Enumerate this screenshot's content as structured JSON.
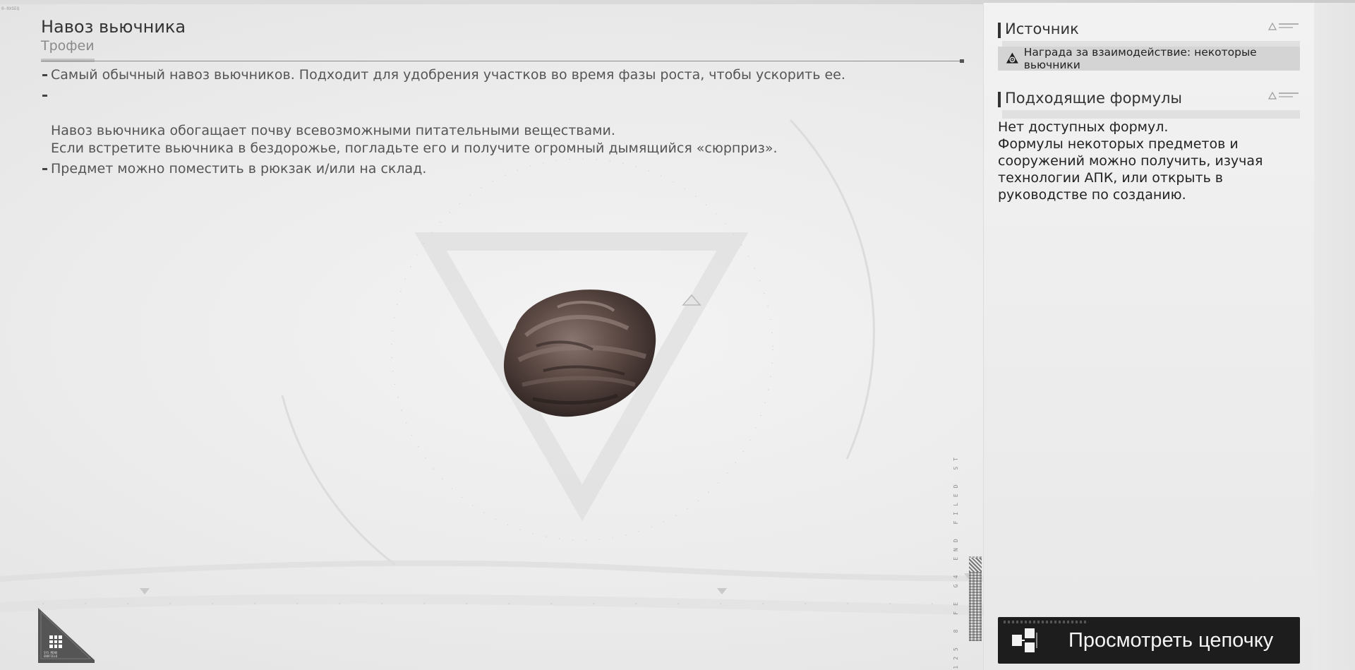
{
  "item": {
    "title": "Навоз вьючника",
    "category": "Трофеи",
    "description": [
      "Самый обычный навоз вьючников. Подходит для удобрения участков во время фазы роста, чтобы ускорить ее.",
      "Навоз вьючника обогащает почву всевозможными питательными веществами.\nЕсли встретите вьючника в бездорожье, погладьте его и получите огромный дымящийся «сюрприз».",
      "Предмет можно поместить в рюкзак и/или на склад."
    ],
    "model_icon": "dung-pile-icon"
  },
  "source": {
    "heading": "Источник",
    "entries": [
      {
        "icon": "interaction-reward-icon",
        "text": "Награда за взаимодействие: некоторые вьючники"
      }
    ]
  },
  "formulas": {
    "heading": "Подходящие формулы",
    "empty_text": "Нет доступных формул.\nФормулы некоторых предметов и сооружений можно получить, изучая технологии АПК, или открыть в руководстве по созданию."
  },
  "actions": {
    "view_chain_label": "Просмотреть цепочку",
    "view_chain_icon": "production-chain-icon",
    "menu_icon": "grid-menu-icon"
  },
  "colors": {
    "background": "#ebebeb",
    "panel": "#efefef",
    "button": "#1d1d1d",
    "text_dark": "#222222",
    "text_muted": "#8a8a8a"
  }
}
